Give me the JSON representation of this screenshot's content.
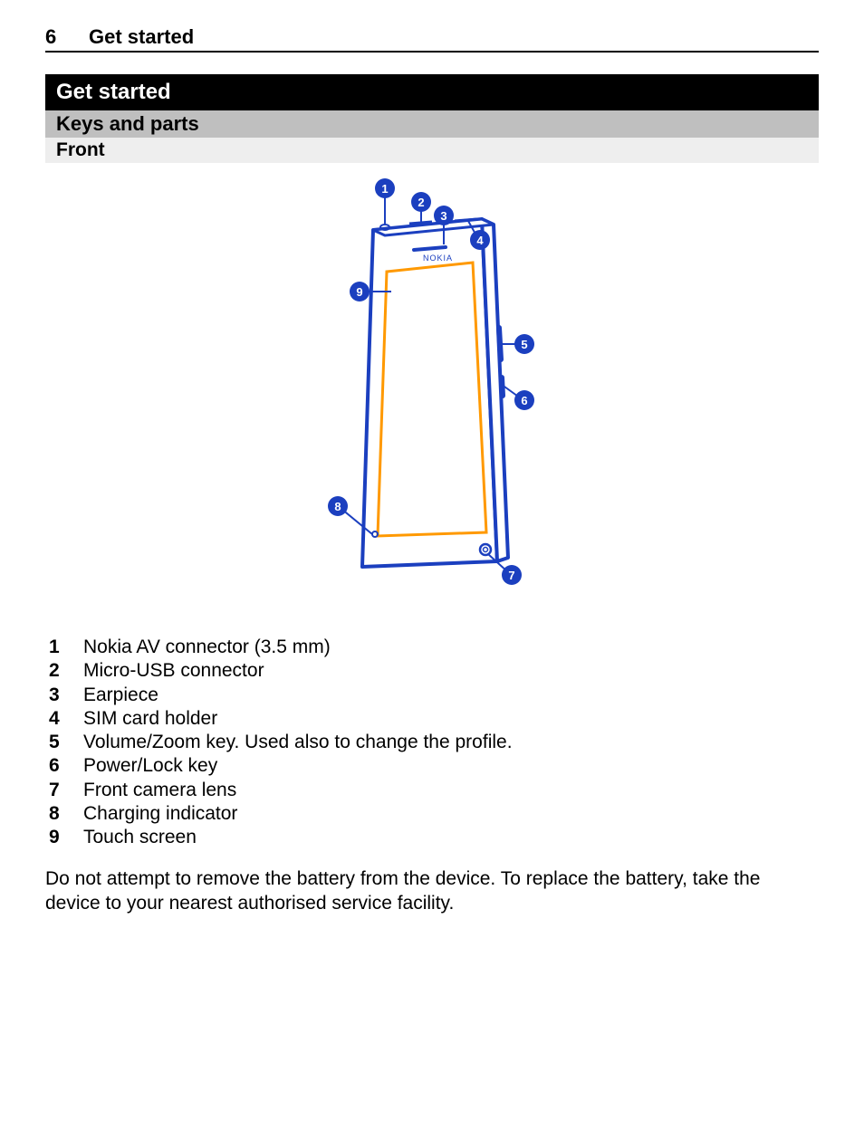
{
  "page_number": "6",
  "running_title": "Get started",
  "section_heading": "Get started",
  "subsection_heading": "Keys and parts",
  "view_heading": "Front",
  "phone_brand": "NOKIA",
  "legend": [
    "Nokia AV connector (3.5 mm)",
    "Micro-USB connector",
    "Earpiece",
    "SIM card holder",
    "Volume/Zoom key. Used also to change the profile.",
    "Power/Lock key",
    "Front camera lens",
    "Charging indicator",
    "Touch screen"
  ],
  "callouts": [
    "1",
    "2",
    "3",
    "4",
    "5",
    "6",
    "7",
    "8",
    "9"
  ],
  "note": "Do not attempt to remove the battery from the device. To replace the battery, take the device to your nearest authorised service facility."
}
